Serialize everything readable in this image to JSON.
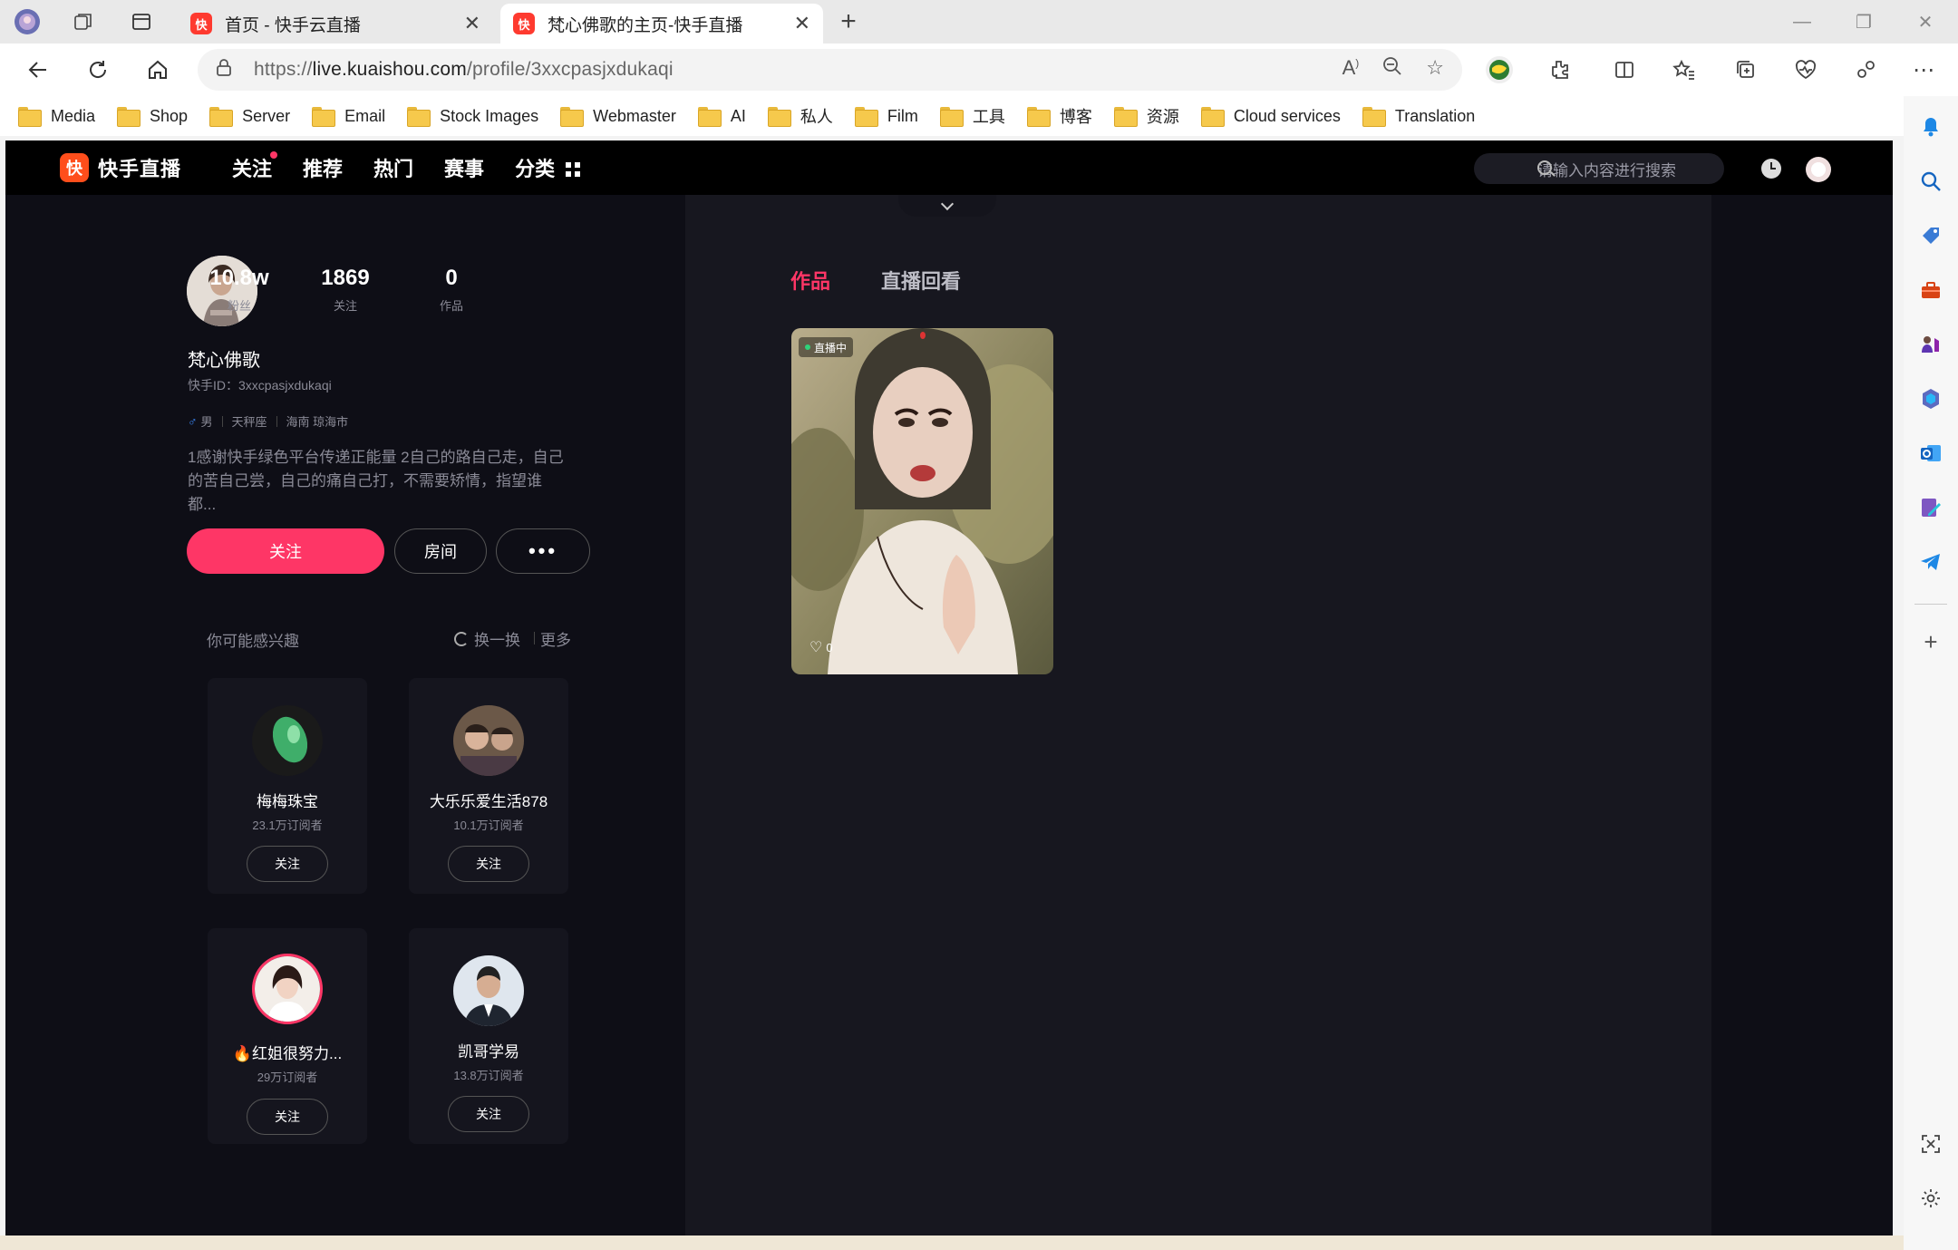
{
  "browser": {
    "tabs": [
      {
        "title": "首页 - 快手云直播",
        "active": false
      },
      {
        "title": "梵心佛歌的主页-快手直播",
        "active": true
      }
    ],
    "url_prefix": "https://",
    "url_host": "live.kuaishou.com",
    "url_path": "/profile/3xxcpasjxdukaqi",
    "bookmarks": [
      "Media",
      "Shop",
      "Server",
      "Email",
      "Stock Images",
      "Webmaster",
      "AI",
      "私人",
      "Film",
      "工具",
      "博客",
      "资源",
      "Cloud services",
      "Translation"
    ]
  },
  "site": {
    "logo_text": "快手直播",
    "nav": [
      "关注",
      "推荐",
      "热门",
      "赛事",
      "分类"
    ],
    "search_placeholder": "请输入内容进行搜索",
    "accent_color": "#fe3666"
  },
  "profile": {
    "stats": [
      {
        "value": "10.8w",
        "label": "粉丝"
      },
      {
        "value": "1869",
        "label": "关注"
      },
      {
        "value": "0",
        "label": "作品"
      }
    ],
    "name": "梵心佛歌",
    "id_line": "快手ID：3xxcpasjxdukaqi",
    "gender": "男",
    "zodiac": "天秤座",
    "location": "海南 琼海市",
    "bio": "1感谢快手绿色平台传递正能量 2自己的路自己走，自己的苦自己尝，自己的痛自己打，不需要矫情，指望谁都...",
    "follow_label": "关注",
    "room_label": "房间",
    "more_label": "•••"
  },
  "recommend": {
    "title": "你可能感兴趣",
    "refresh_label": "换一换",
    "more_label": "更多",
    "users": [
      {
        "name": "梅梅珠宝",
        "subs": "23.1万订阅者",
        "btn": "关注"
      },
      {
        "name": "大乐乐爱生活878",
        "subs": "10.1万订阅者",
        "btn": "关注"
      },
      {
        "name": "红姐很努力...",
        "subs": "29万订阅者",
        "btn": "关注"
      },
      {
        "name": "凯哥学易",
        "subs": "13.8万订阅者",
        "btn": "关注"
      }
    ]
  },
  "content": {
    "tabs": [
      "作品",
      "直播回看"
    ],
    "video": {
      "badge": "直播中",
      "likes": "0"
    }
  }
}
